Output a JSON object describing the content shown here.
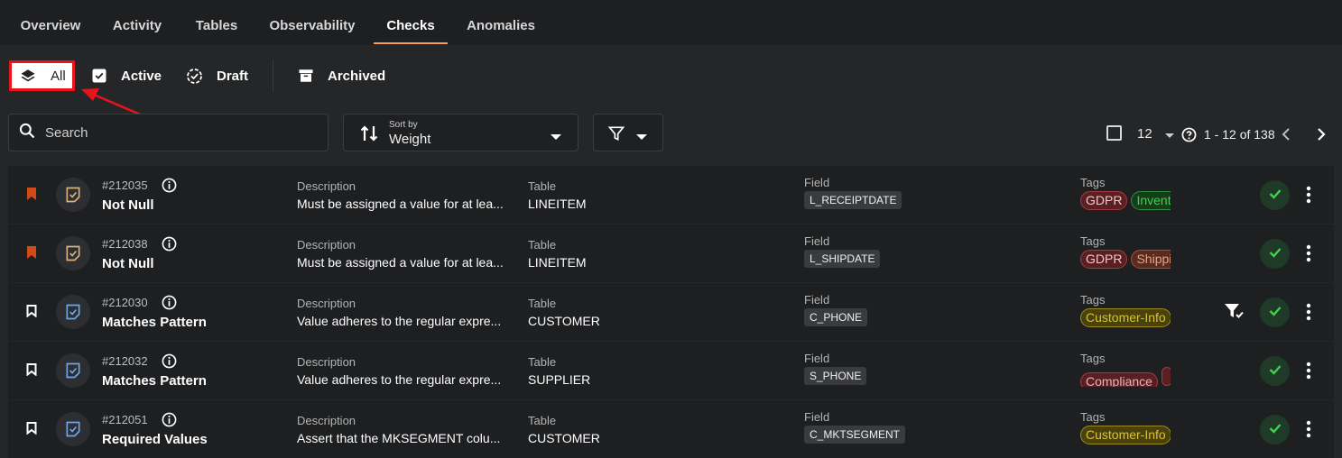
{
  "tabs": [
    {
      "label": "Overview"
    },
    {
      "label": "Activity"
    },
    {
      "label": "Tables"
    },
    {
      "label": "Observability"
    },
    {
      "label": "Checks"
    },
    {
      "label": "Anomalies"
    }
  ],
  "status_filters": {
    "all": "All",
    "active": "Active",
    "draft": "Draft",
    "archived": "Archived"
  },
  "search": {
    "placeholder": "Search"
  },
  "sort": {
    "label": "Sort by",
    "value": "Weight"
  },
  "pagination": {
    "page_size": "12",
    "range": "1 - 12 of 138"
  },
  "columns": {
    "description": "Description",
    "table": "Table",
    "field": "Field",
    "tags": "Tags"
  },
  "rows": [
    {
      "id": "#212035",
      "name": "Not Null",
      "description": "Must be assigned a value for at lea...",
      "table": "LINEITEM",
      "field": "L_RECEIPTDATE",
      "tags": [
        {
          "label": "GDPR",
          "kind": "gdpr"
        },
        {
          "label": "Inventory",
          "kind": "inv"
        }
      ],
      "bookmarked": true
    },
    {
      "id": "#212038",
      "name": "Not Null",
      "description": "Must be assigned a value for at lea...",
      "table": "LINEITEM",
      "field": "L_SHIPDATE",
      "tags": [
        {
          "label": "GDPR",
          "kind": "gdpr"
        },
        {
          "label": "Shipping",
          "kind": "ship"
        }
      ],
      "bookmarked": true
    },
    {
      "id": "#212030",
      "name": "Matches Pattern",
      "description": "Value adheres to the regular expre...",
      "table": "CUSTOMER",
      "field": "C_PHONE",
      "tags": [
        {
          "label": "Customer-Info",
          "kind": "cust"
        }
      ],
      "bookmarked": false
    },
    {
      "id": "#212032",
      "name": "Matches Pattern",
      "description": "Value adheres to the regular expre...",
      "table": "SUPPLIER",
      "field": "S_PHONE",
      "tags": [
        {
          "label": "Compliance",
          "kind": "comp"
        },
        {
          "label": "",
          "kind": "comp"
        }
      ],
      "bookmarked": false
    },
    {
      "id": "#212051",
      "name": "Required Values",
      "description": "Assert that the MKSEGMENT colu...",
      "table": "CUSTOMER",
      "field": "C_MKTSEGMENT",
      "tags": [
        {
          "label": "Customer-Info",
          "kind": "cust"
        }
      ],
      "bookmarked": false
    }
  ]
}
